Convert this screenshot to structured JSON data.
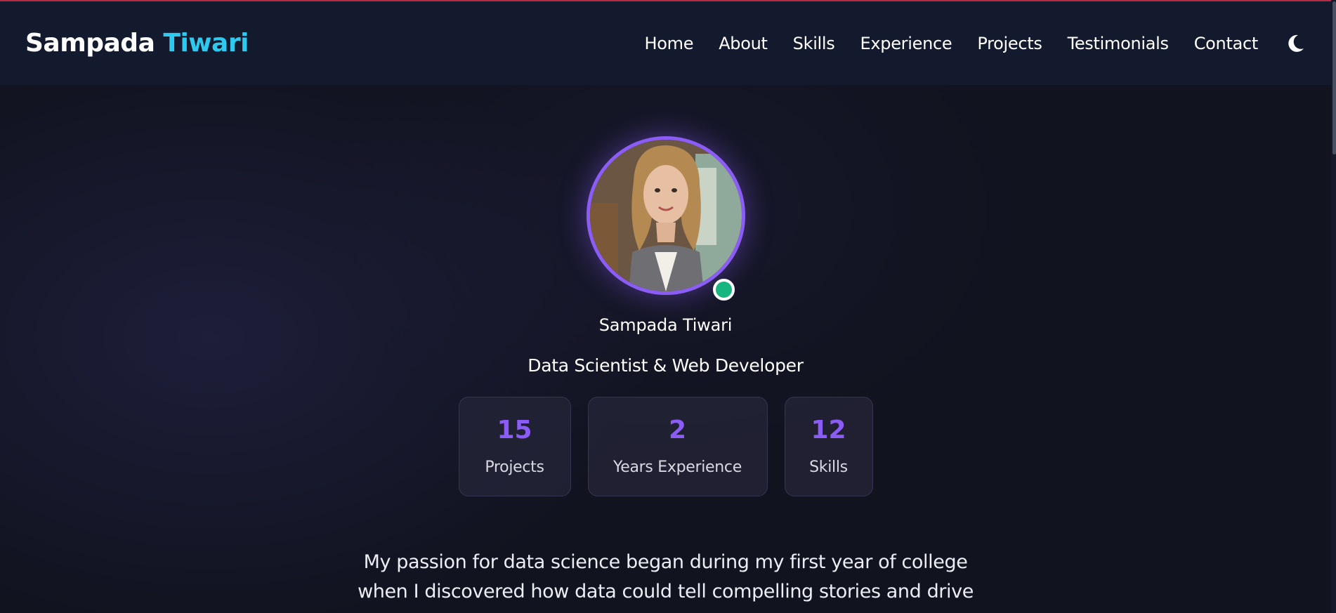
{
  "header": {
    "brand_first": "Sampada",
    "brand_last": "Tiwari",
    "nav": [
      "Home",
      "About",
      "Skills",
      "Experience",
      "Projects",
      "Testimonials",
      "Contact"
    ],
    "theme_icon": "moon-icon"
  },
  "profile": {
    "name": "Sampada Tiwari",
    "role": "Data Scientist & Web Developer",
    "status": "online",
    "photo_icon": "avatar-photo"
  },
  "stats": [
    {
      "value": "15",
      "label": "Projects"
    },
    {
      "value": "2",
      "label": "Years Experience"
    },
    {
      "value": "12",
      "label": "Skills"
    }
  ],
  "bio": {
    "line1": "My passion for data science began during my first year of college",
    "line2": "when I discovered how data could tell compelling stories and drive"
  },
  "colors": {
    "accent_purple": "#8b5cf6",
    "brand_cyan": "#2ec9ef",
    "status_green": "#17b57f",
    "background": "#11131f",
    "header": "#141a2e"
  }
}
